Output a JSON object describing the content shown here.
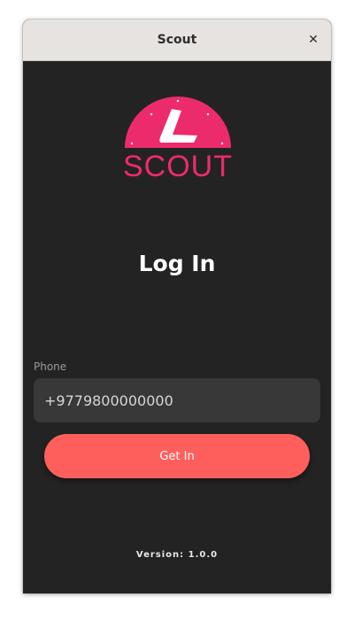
{
  "window": {
    "title": "Scout",
    "close_label": "✕"
  },
  "logo": {
    "text": "SCOUT",
    "color": "#ec2b6c"
  },
  "heading": "Log In",
  "form": {
    "phone_label": "Phone",
    "phone_value": "+9779800000000",
    "submit_label": "Get In",
    "button_color": "#fe5f5d"
  },
  "footer": {
    "version": "Version: 1.0.0"
  },
  "icons": {
    "close": "close-icon",
    "logo": "scout-logo-icon"
  }
}
